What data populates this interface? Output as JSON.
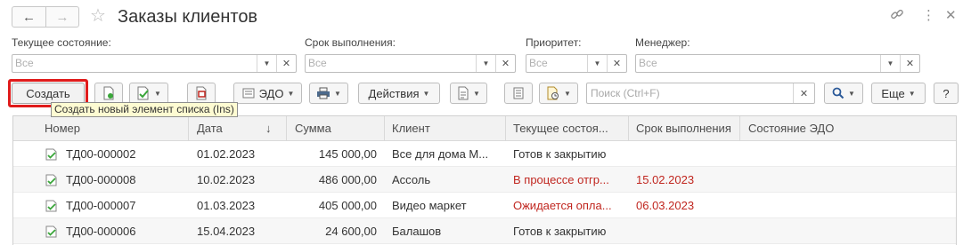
{
  "nav": {
    "back_icon": "arrow-left-icon",
    "forward_icon": "arrow-right-icon",
    "favorite_icon": "star-icon"
  },
  "window": {
    "title": "Заказы клиентов",
    "icons": [
      "link-icon",
      "more-vertical-icon",
      "close-icon"
    ]
  },
  "filters": [
    {
      "label": "Текущее состояние:",
      "placeholder": "Все"
    },
    {
      "label": "Срок выполнения:",
      "placeholder": "Все"
    },
    {
      "label": "Приоритет:",
      "placeholder": "Все"
    },
    {
      "label": "Менеджер:",
      "placeholder": "Все"
    }
  ],
  "toolbar": {
    "create_label": "Создать",
    "create_tooltip": "Создать новый элемент списка (Ins)",
    "edo_label": "ЭДО",
    "actions_label": "Действия",
    "search_placeholder": "Поиск (Ctrl+F)",
    "more_label": "Еще",
    "help_label": "?"
  },
  "table": {
    "columns": [
      "Номер",
      "Дата",
      "Сумма",
      "Клиент",
      "Текущее состоя...",
      "Срок выполнения",
      "Состояние ЭДО"
    ],
    "sort_indicator": "↓",
    "rows": [
      {
        "number": "ТД00-000002",
        "date": "01.02.2023",
        "sum": "145 000,00",
        "client": "Все для дома М...",
        "state": "Готов к закрытию",
        "state_alert": false,
        "deadline": "",
        "edo": ""
      },
      {
        "number": "ТД00-000008",
        "date": "10.02.2023",
        "sum": "486 000,00",
        "client": "Ассоль",
        "state": "В процессе отгр...",
        "state_alert": true,
        "deadline": "15.02.2023",
        "edo": ""
      },
      {
        "number": "ТД00-000007",
        "date": "01.03.2023",
        "sum": "405 000,00",
        "client": "Видео маркет",
        "state": "Ожидается опла...",
        "state_alert": true,
        "deadline": "06.03.2023",
        "edo": ""
      },
      {
        "number": "ТД00-000006",
        "date": "15.04.2023",
        "sum": "24 600,00",
        "client": "Балашов",
        "state": "Готов к закрытию",
        "state_alert": false,
        "deadline": "",
        "edo": ""
      }
    ]
  },
  "colors": {
    "alert": "#c0261f",
    "highlight": "#e01b1b",
    "tooltip_bg": "#fefbd2",
    "doc_icon": "#3aa63a"
  }
}
